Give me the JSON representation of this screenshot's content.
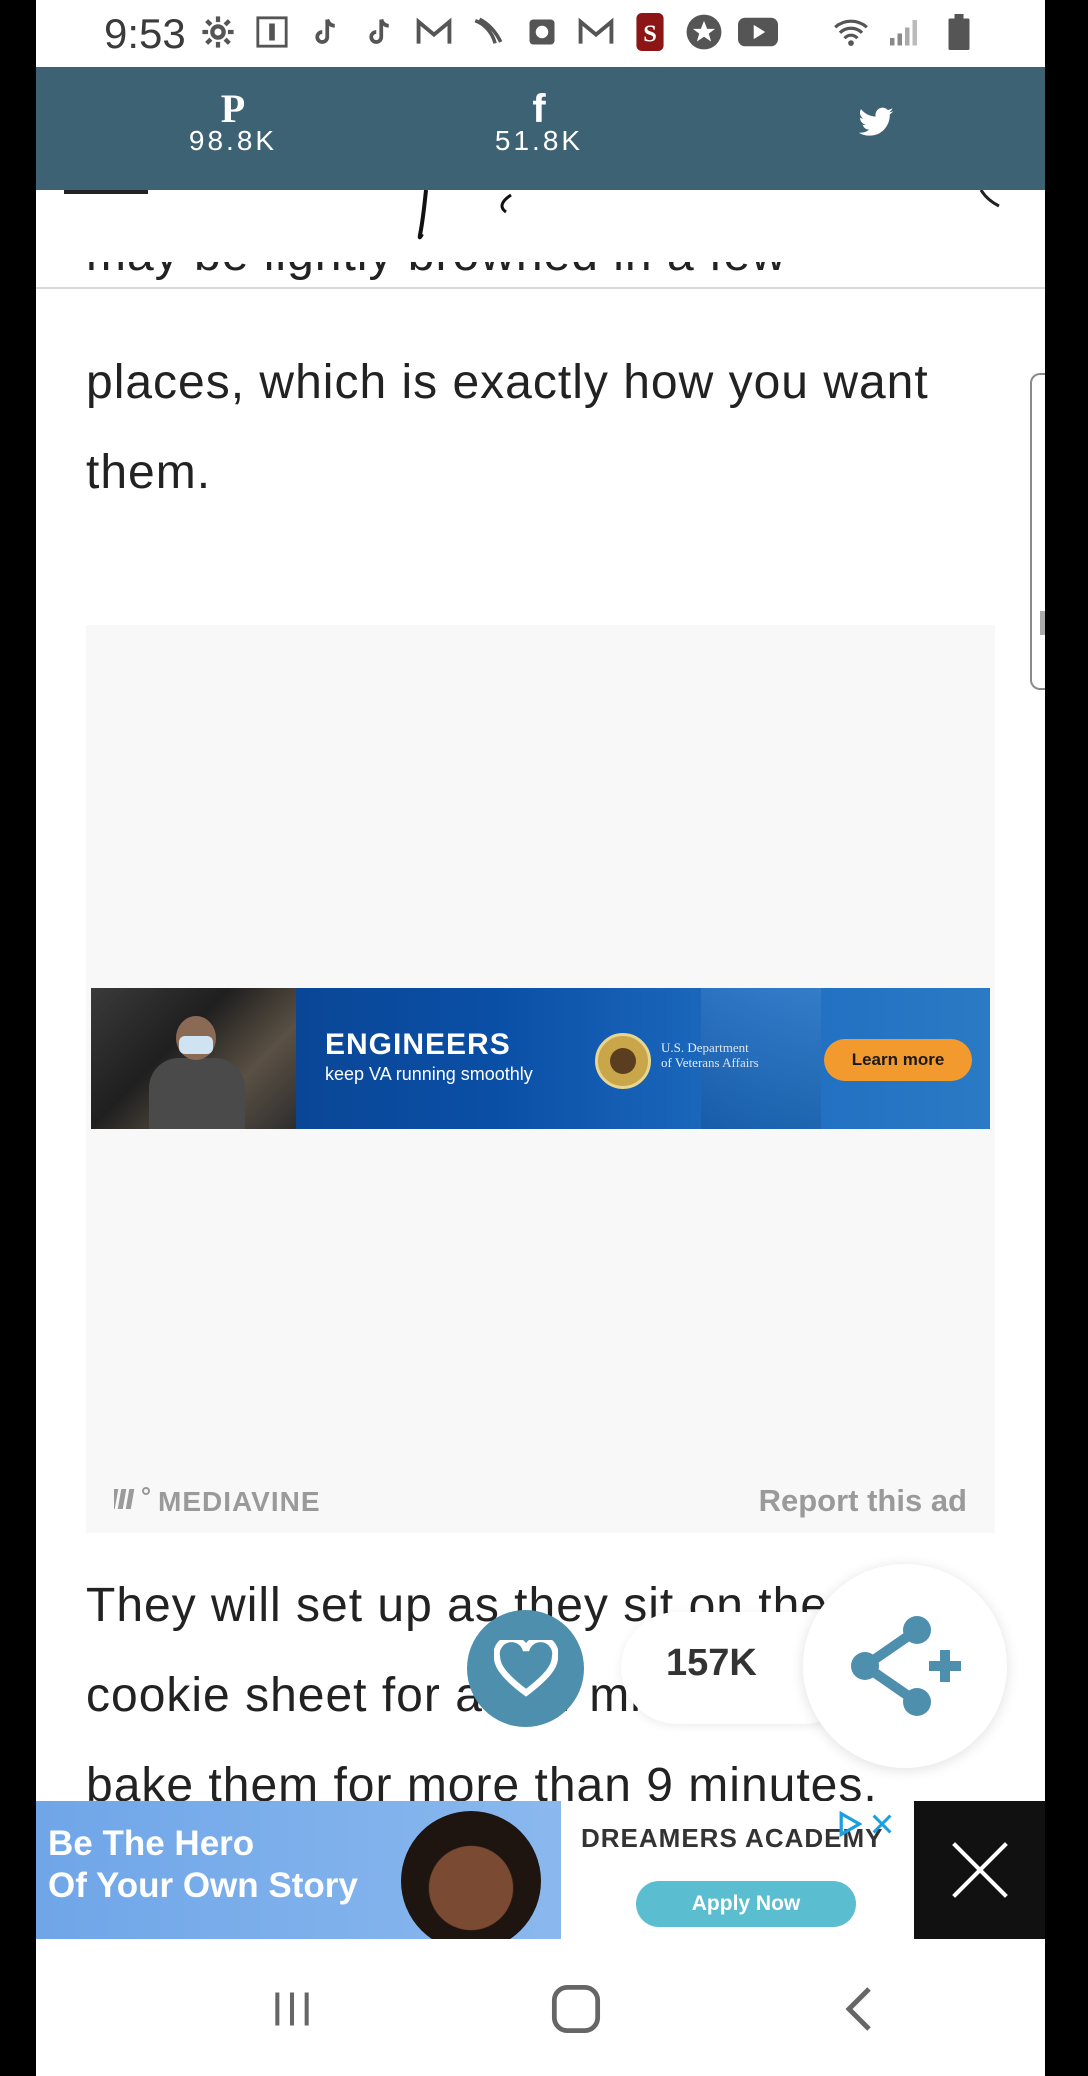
{
  "status_bar": {
    "time": "9:53",
    "left_icons": [
      "gear-icon",
      "info-box-icon",
      "tiktok-icon",
      "tiktok-icon",
      "gmail-icon",
      "sprint-icon",
      "clock-app-icon",
      "gmail-icon",
      "stanford-icon",
      "star-circle-icon",
      "youtube-icon"
    ],
    "right_icons": [
      "wifi-icon",
      "signal-icon",
      "battery-icon"
    ]
  },
  "share_bar": {
    "pinterest": {
      "glyph": "P",
      "count": "98.8K"
    },
    "facebook": {
      "glyph": "f",
      "count": "51.8K"
    },
    "twitter": {
      "glyph": "twitter-icon"
    }
  },
  "article": {
    "partial_top_line": "may be lightly browned in a few",
    "para1_lines": [
      "places, which is exactly how you want",
      "them."
    ],
    "para2_lines": [
      "They will set up as they sit on the",
      "cookie sheet for a few minutes.",
      "bake them for more than 9 minutes."
    ]
  },
  "ad_block": {
    "engineers_title": "ENGINEERS",
    "engineers_subtitle": "keep VA running smoothly",
    "dept_line1": "U.S. Department",
    "dept_line2": "of Veterans Affairs",
    "learn_more": "Learn more",
    "mediavine_label": "MEDIAVINE",
    "report_label": "Report this ad"
  },
  "floating_share": {
    "count": "157K"
  },
  "bottom_ad": {
    "headline_line1": "Be The Hero",
    "headline_line2": "Of Your Own Story",
    "brand": "DREAMERS ACADEMY",
    "apply_label": "Apply Now"
  },
  "colors": {
    "share_bar_bg": "#3d6273",
    "favorite_button": "#4e8fae",
    "share_icon": "#4e8fae",
    "learn_more_button": "#f29a2e",
    "apply_button": "#5bbdd0"
  }
}
